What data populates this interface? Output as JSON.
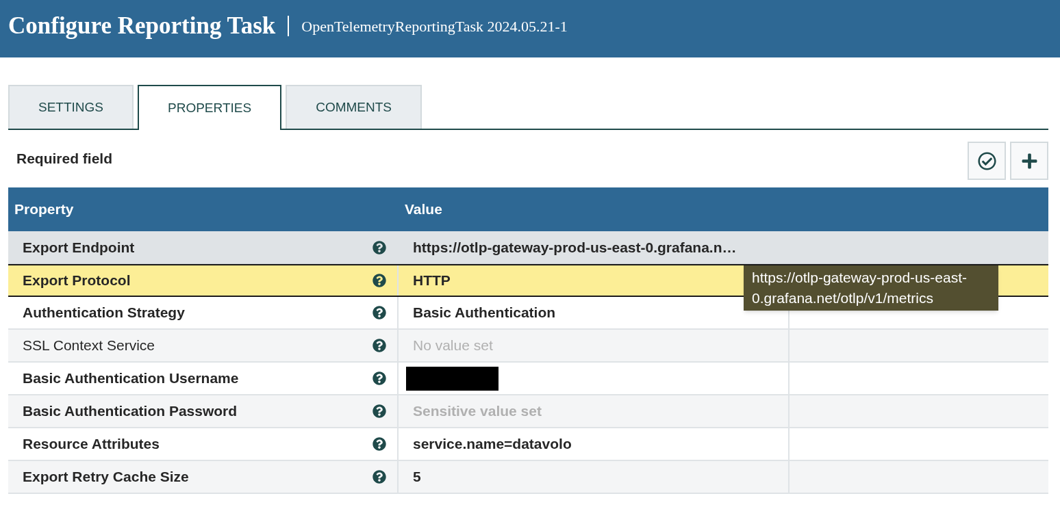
{
  "header": {
    "title": "Configure Reporting Task",
    "subtitle": "OpenTelemetryReportingTask 2024.05.21-1"
  },
  "tabs": [
    {
      "label": "SETTINGS",
      "selected": false
    },
    {
      "label": "PROPERTIES",
      "selected": true
    },
    {
      "label": "COMMENTS",
      "selected": false
    }
  ],
  "required_label": "Required field",
  "table": {
    "columns": [
      "Property",
      "Value"
    ],
    "rows": [
      {
        "name": "Export Endpoint",
        "required": true,
        "kind": "text",
        "value": "https://otlp-gateway-prod-us-east-0.grafana.n…",
        "hovered": true,
        "selected": false
      },
      {
        "name": "Export Protocol",
        "required": true,
        "kind": "text",
        "value": "HTTP",
        "hovered": false,
        "selected": true
      },
      {
        "name": "Authentication Strategy",
        "required": true,
        "kind": "text",
        "value": "Basic Authentication",
        "hovered": false,
        "selected": false
      },
      {
        "name": "SSL Context Service",
        "required": false,
        "kind": "empty",
        "value": "No value set",
        "hovered": false,
        "selected": false
      },
      {
        "name": "Basic Authentication Username",
        "required": true,
        "kind": "redacted",
        "hovered": false,
        "selected": false
      },
      {
        "name": "Basic Authentication Password",
        "required": true,
        "kind": "sensitive",
        "value": "Sensitive value set",
        "hovered": false,
        "selected": false
      },
      {
        "name": "Resource Attributes",
        "required": true,
        "kind": "text",
        "value": "service.name=datavolo",
        "hovered": false,
        "selected": false
      },
      {
        "name": "Export Retry Cache Size",
        "required": true,
        "kind": "text",
        "value": "5",
        "hovered": false,
        "selected": false
      }
    ]
  },
  "tooltip": {
    "text": "https://otlp-gateway-prod-us-east-0.grafana.net/otlp/v1/metrics"
  }
}
